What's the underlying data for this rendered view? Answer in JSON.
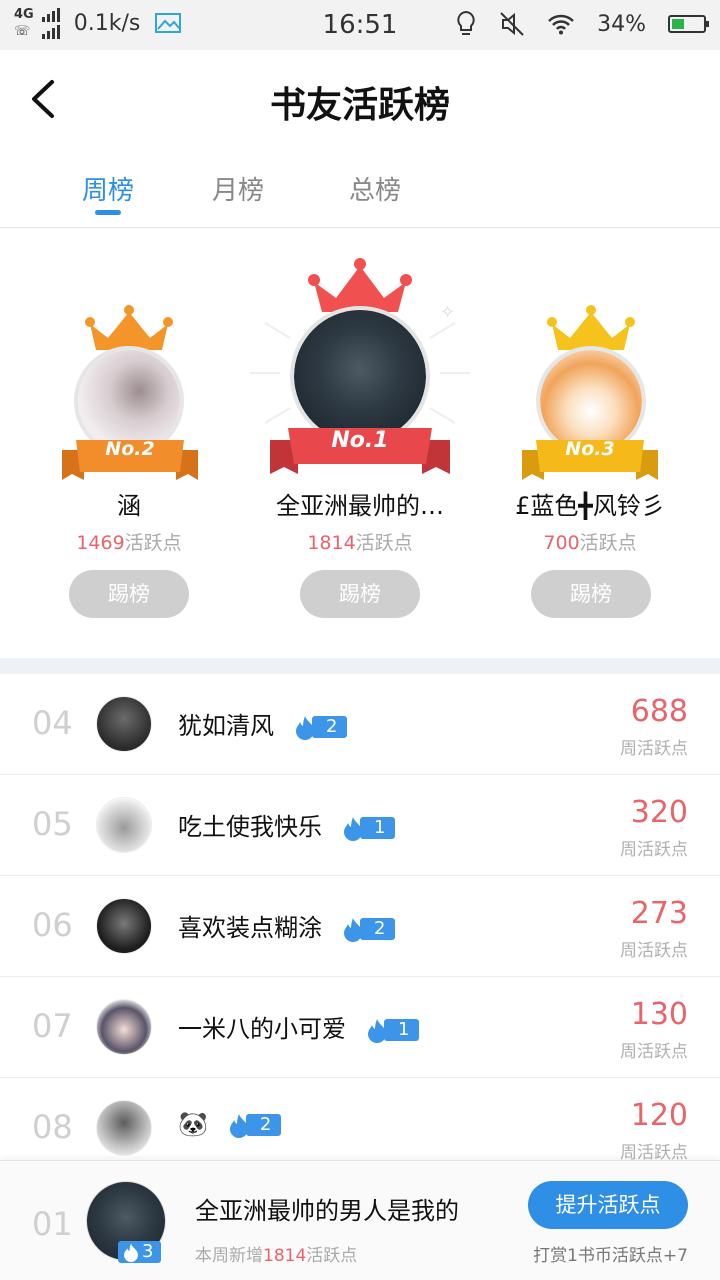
{
  "status_bar": {
    "network": "4G",
    "speed": "0.1k/s",
    "time": "16:51",
    "battery": "34%"
  },
  "header": {
    "title": "书友活跃榜"
  },
  "tabs": [
    {
      "label": "周榜",
      "active": true
    },
    {
      "label": "月榜",
      "active": false
    },
    {
      "label": "总榜",
      "active": false
    }
  ],
  "podium": [
    {
      "badge": "No.1",
      "name": "全亚洲最帅的…",
      "score": "1814",
      "unit": "活跃点",
      "button": "踢榜",
      "crown_color": "#f0504f",
      "ribbon_color": "#e8474c"
    },
    {
      "badge": "No.2",
      "name": "涵",
      "score": "1469",
      "unit": "活跃点",
      "button": "踢榜",
      "crown_color": "#f4952a",
      "ribbon_color": "#f18d2a"
    },
    {
      "badge": "No.3",
      "name": "£蓝色╋风铃彡",
      "score": "700",
      "unit": "活跃点",
      "button": "踢榜",
      "crown_color": "#f6c31c",
      "ribbon_color": "#f6b91a"
    }
  ],
  "list": [
    {
      "rank": "04",
      "name": "犹如清风",
      "fire": "2",
      "score": "688",
      "label": "周活跃点"
    },
    {
      "rank": "05",
      "name": "吃土使我快乐",
      "fire": "1",
      "score": "320",
      "label": "周活跃点"
    },
    {
      "rank": "06",
      "name": "喜欢装点糊涂",
      "fire": "2",
      "score": "273",
      "label": "周活跃点"
    },
    {
      "rank": "07",
      "name": "一米八的小可爱",
      "fire": "1",
      "score": "130",
      "label": "周活跃点"
    },
    {
      "rank": "08",
      "name": "🐼",
      "fire": "2",
      "score": "120",
      "label": "周活跃点"
    }
  ],
  "footer": {
    "rank": "01",
    "fire": "3",
    "name": "全亚洲最帅的男人是我的",
    "sub_prefix": "本周新增",
    "sub_value": "1814",
    "sub_suffix": "活跃点",
    "button": "提升活跃点",
    "tip": "打赏1书币活跃点+7"
  },
  "colors": {
    "accent": "#2f8fe6",
    "score": "#e9646a",
    "fire_badge": "#3d95ea"
  }
}
